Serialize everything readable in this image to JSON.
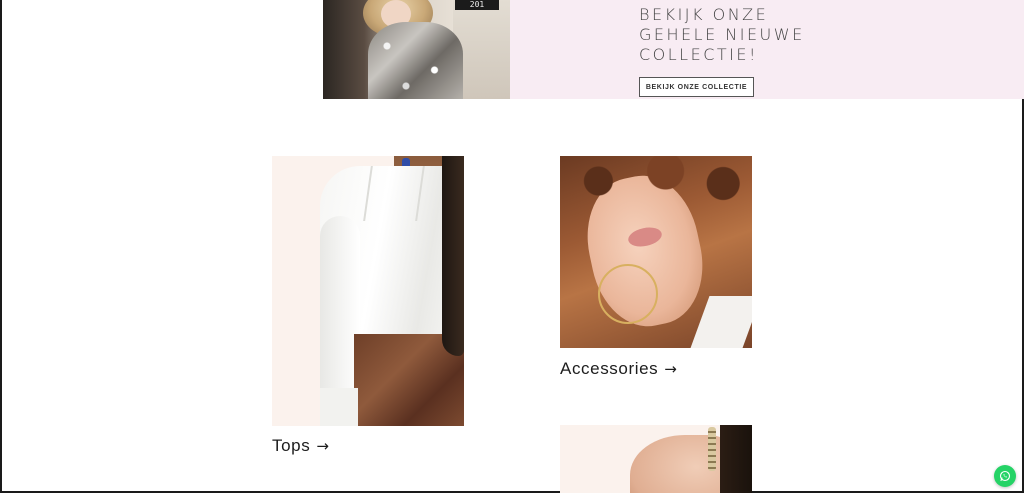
{
  "hero": {
    "title": "BEKIJK ONZE\nGEHELE NIEUWE\nCOLLECTIE!",
    "button_label": "BEKIJK ONZE COLLECTIE",
    "photo_plate_text": "201",
    "background_color": "#f8ecf3"
  },
  "categories": [
    {
      "label": "Tops",
      "arrow": "→"
    },
    {
      "label": "Accessories",
      "arrow": "→"
    },
    {
      "label": "",
      "arrow": ""
    }
  ],
  "floating": {
    "whatsapp_icon": "whatsapp-icon",
    "whatsapp_color": "#25d366"
  }
}
